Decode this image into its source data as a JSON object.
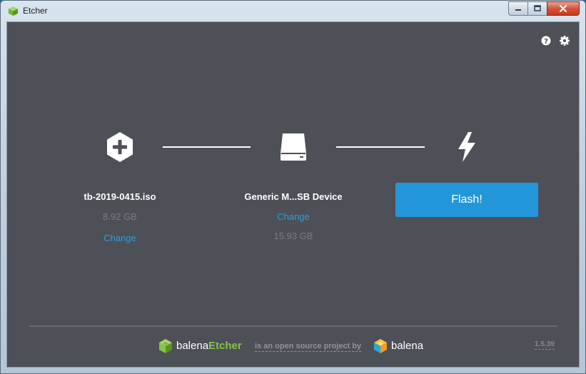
{
  "window": {
    "title": "Etcher"
  },
  "steps": {
    "image": {
      "name": "tb-2019-0415.iso",
      "size": "8.92 GB",
      "change_label": "Change"
    },
    "drive": {
      "name": "Generic M...SB Device",
      "change_label": "Change",
      "size": "15.93 GB"
    },
    "flash": {
      "button_label": "Flash!"
    }
  },
  "footer": {
    "brand_prefix": "balena",
    "brand_accent": "Etcher",
    "note": "is an open source project by",
    "company": "balena",
    "version": "1.5.39"
  },
  "colors": {
    "background": "#4d5057",
    "accent_blue": "#2396d9",
    "link_blue": "#2a9fd8",
    "brand_green": "#85c541"
  },
  "icons": [
    "help-icon",
    "settings-icon",
    "plus-hexagon-icon",
    "drive-icon",
    "lightning-icon",
    "etcher-cube-icon",
    "balena-cube-icon"
  ]
}
